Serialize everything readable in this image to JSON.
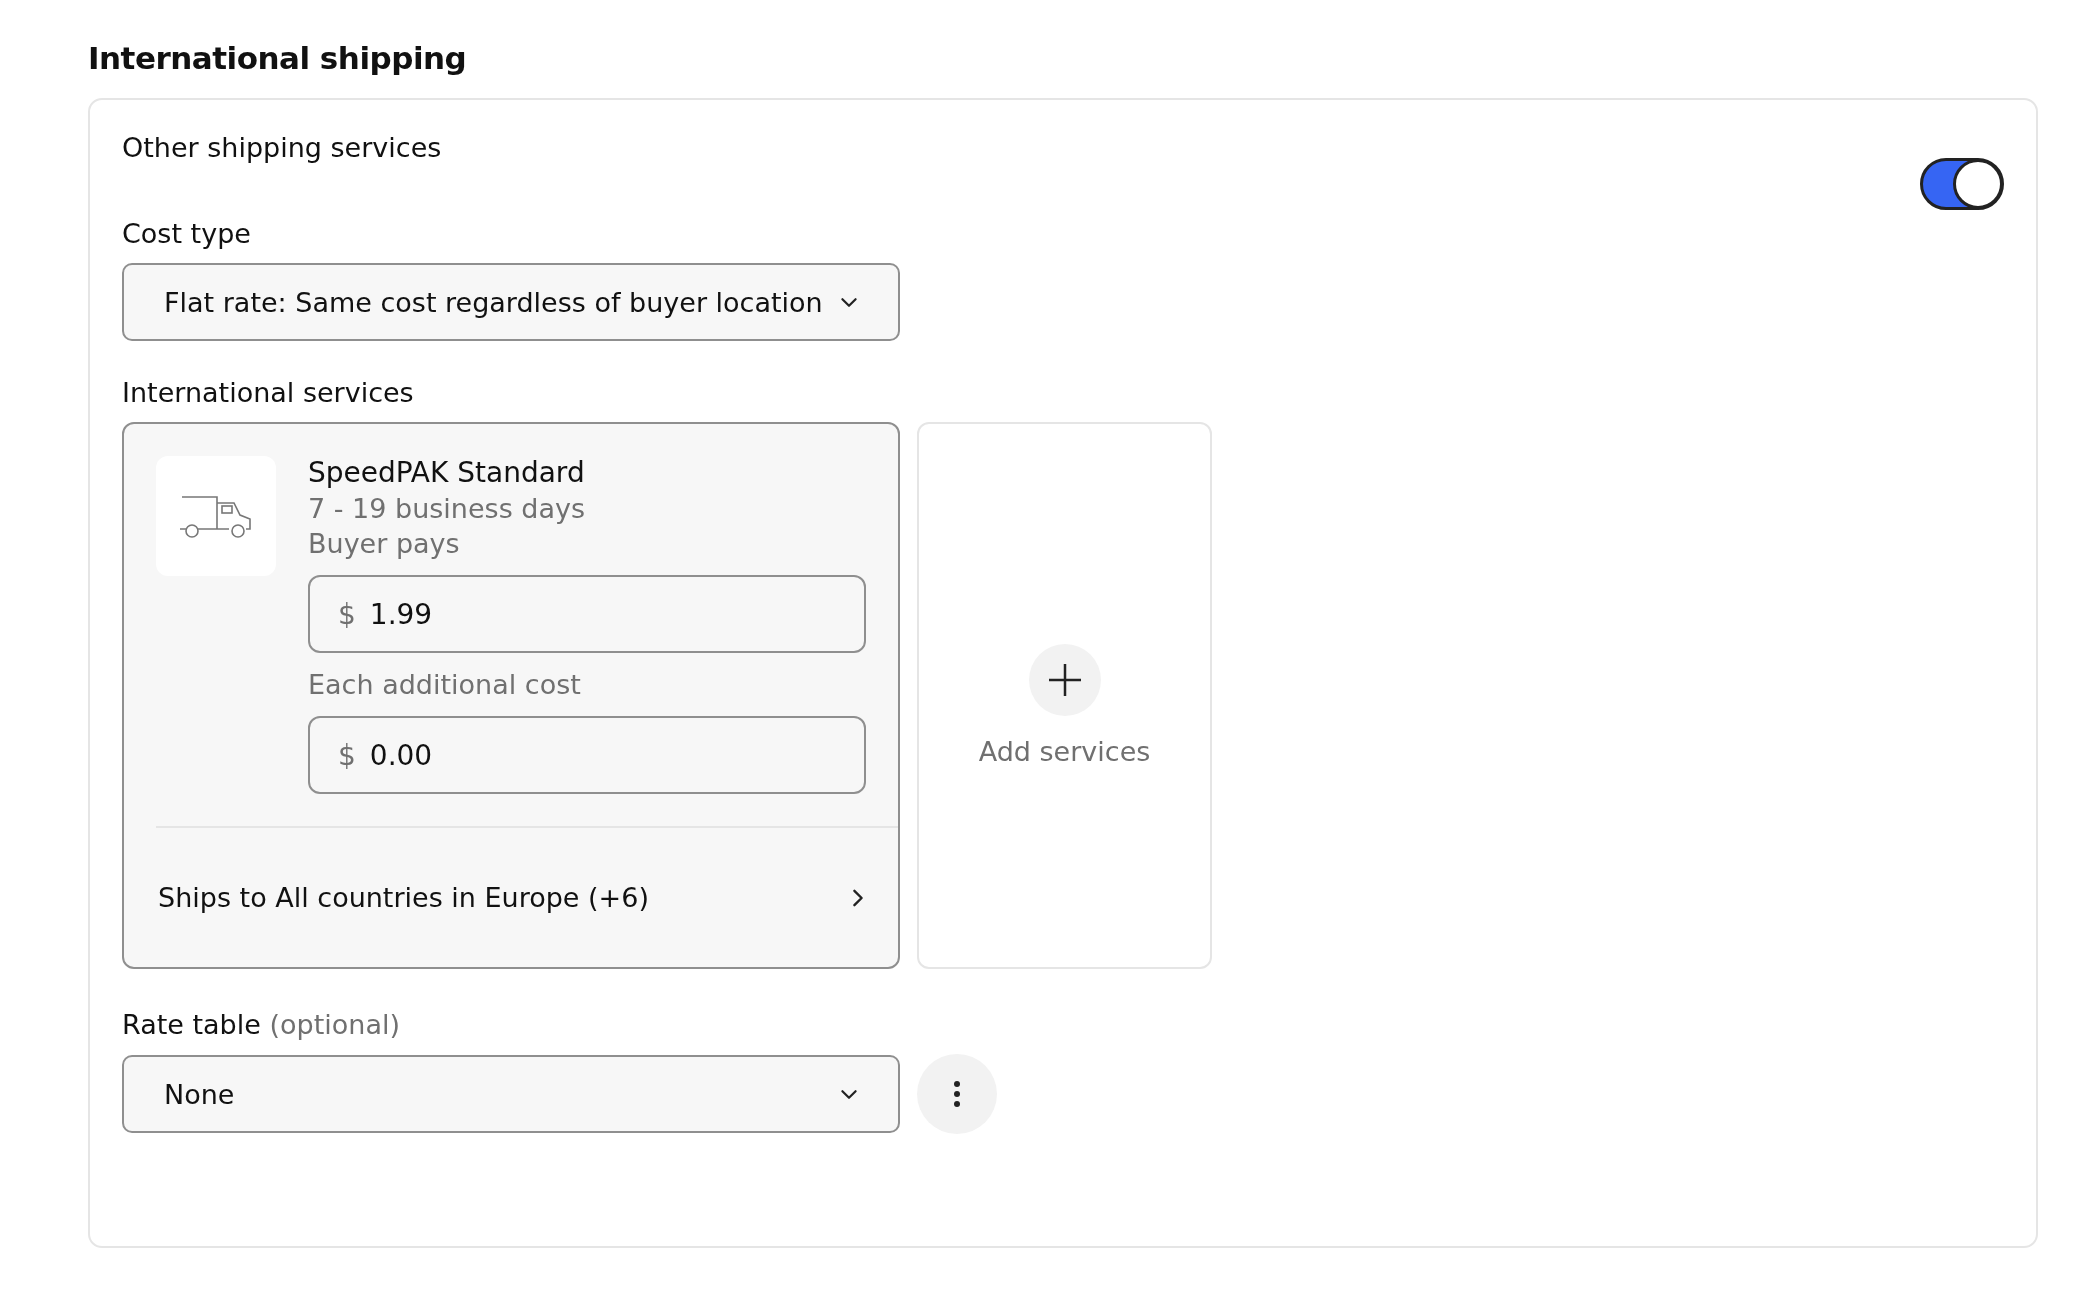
{
  "heading": "International shipping",
  "panel": {
    "title": "Other shipping services",
    "toggle": {
      "on": true
    },
    "cost_type": {
      "label": "Cost type",
      "value": "Flat rate: Same cost regardless of buyer location"
    },
    "services_label": "International services",
    "service": {
      "name": "SpeedPAK Standard",
      "time": "7 - 19 business days",
      "payer": "Buyer pays",
      "currency": "$",
      "cost": "1.99",
      "additional_label": "Each additional cost",
      "additional_currency": "$",
      "additional_cost": "0.00",
      "ships_to": "Ships to All countries in Europe (+6)"
    },
    "add_services": "Add services",
    "rate_table": {
      "label": "Rate table",
      "optional": "(optional)",
      "value": "None"
    }
  }
}
